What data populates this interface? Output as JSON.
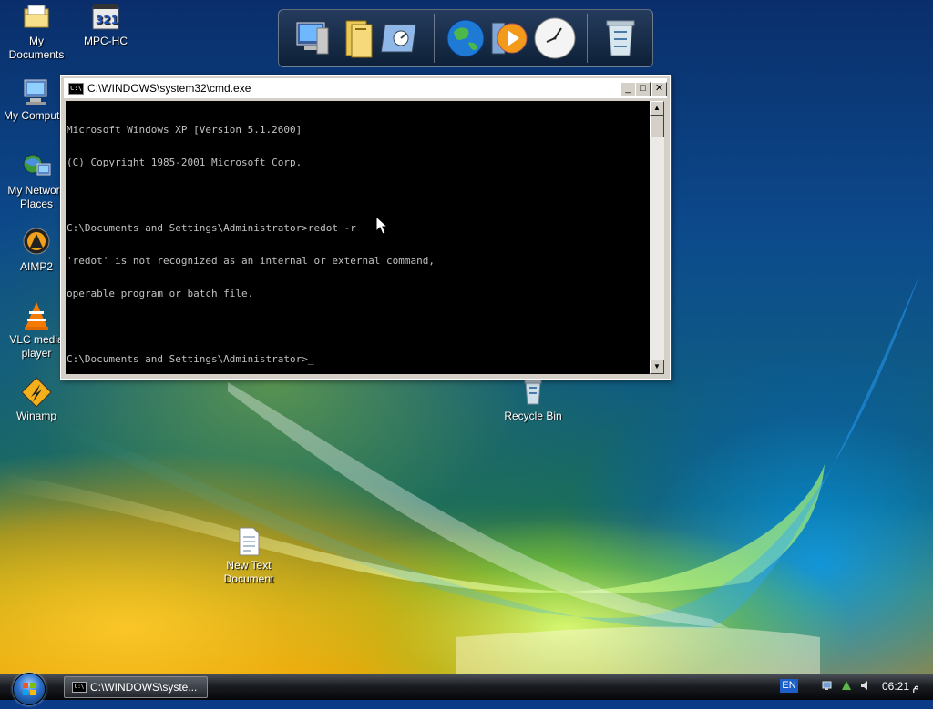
{
  "desktop": {
    "icons": [
      {
        "label": "My\nDocuments",
        "icon": "my-documents-icon"
      },
      {
        "label": "MPC-HC",
        "icon": "mpc-hc-icon"
      },
      {
        "label": "My Computer",
        "icon": "my-computer-icon"
      },
      {
        "label": "My Network\nPlaces",
        "icon": "network-places-icon"
      },
      {
        "label": "AIMP2",
        "icon": "aimp-icon"
      },
      {
        "label": "VLC media\nplayer",
        "icon": "vlc-icon"
      },
      {
        "label": "Winamp",
        "icon": "winamp-icon"
      },
      {
        "label": "Recycle Bin",
        "icon": "recycle-bin-icon"
      },
      {
        "label": "New Text\nDocument",
        "icon": "text-document-icon"
      }
    ],
    "mpc_badge": "321"
  },
  "dock": {
    "items": [
      "computer-icon",
      "folder-icon",
      "control-panel-icon",
      "internet-globe-icon",
      "media-player-icon",
      "clock-icon",
      "recycle-bin-icon"
    ]
  },
  "cmd": {
    "title": "C:\\WINDOWS\\system32\\cmd.exe",
    "app_icon_text": "C:\\",
    "lines": [
      "Microsoft Windows XP [Version 5.1.2600]",
      "(C) Copyright 1985-2001 Microsoft Corp.",
      "",
      "C:\\Documents and Settings\\Administrator>redot -r",
      "'redot' is not recognized as an internal or external command,",
      "operable program or batch file.",
      "",
      "C:\\Documents and Settings\\Administrator>_"
    ],
    "minimize": "_",
    "maximize": "□",
    "close": "✕",
    "scroll_up": "▲",
    "scroll_down": "▼"
  },
  "taskbar": {
    "task_label": "C:\\WINDOWS\\syste...",
    "task_icon_text": "C:\\",
    "language": "EN",
    "clock": "06:21 م"
  },
  "colors": {
    "console_bg": "#000000",
    "console_text": "#c0c0c0",
    "language_badge": "#1d5fc8"
  }
}
